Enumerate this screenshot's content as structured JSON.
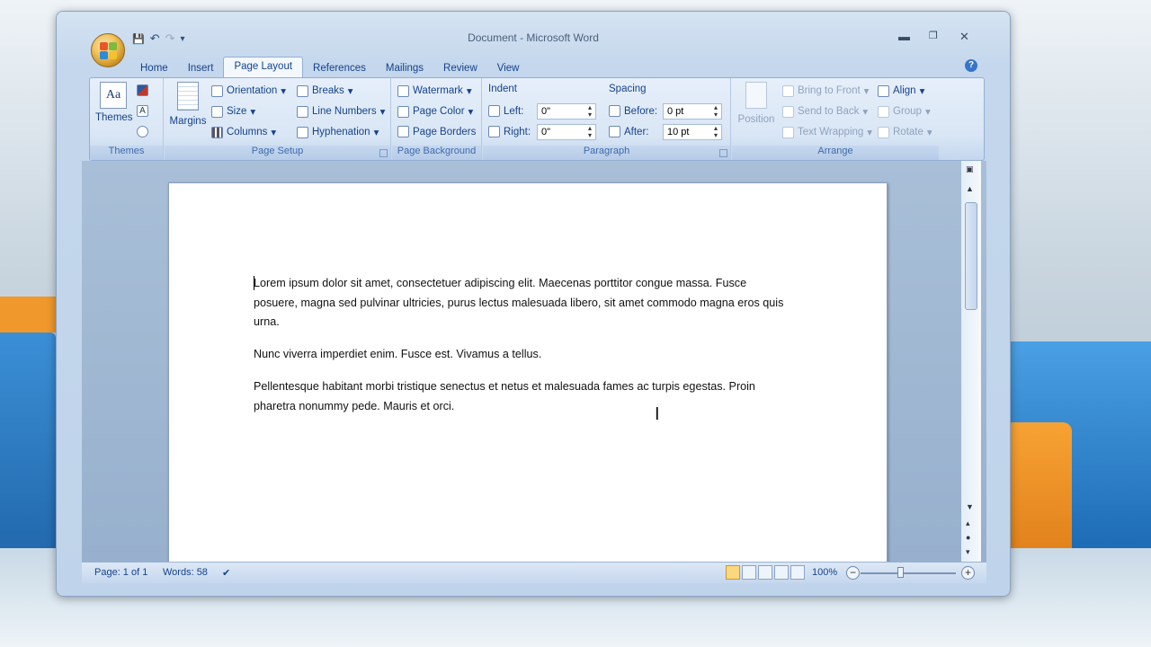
{
  "window": {
    "title": "Document - Microsoft Word",
    "minimize": "▬",
    "maximize": "❐",
    "close": "✕"
  },
  "qat": {
    "save": "💾",
    "undo": "↶",
    "redo": "↷",
    "customize": "▾"
  },
  "tabs": [
    "Home",
    "Insert",
    "Page Layout",
    "References",
    "Mailings",
    "Review",
    "View"
  ],
  "active_tab": "Page Layout",
  "help": "?",
  "ribbon": {
    "themes": {
      "label": "Themes",
      "group": "Themes",
      "themes_icon_text": "Aa"
    },
    "page_setup": {
      "group": "Page Setup",
      "margins": "Margins",
      "orientation": "Orientation",
      "size": "Size",
      "columns": "Columns",
      "breaks": "Breaks",
      "line_numbers": "Line Numbers",
      "hyphenation": "Hyphenation"
    },
    "page_background": {
      "group": "Page Background",
      "watermark": "Watermark",
      "page_color": "Page Color",
      "page_borders": "Page Borders"
    },
    "paragraph": {
      "group": "Paragraph",
      "indent_header": "Indent",
      "spacing_header": "Spacing",
      "left_label": "Left:",
      "left_value": "0\"",
      "right_label": "Right:",
      "right_value": "0\"",
      "before_label": "Before:",
      "before_value": "0 pt",
      "after_label": "After:",
      "after_value": "10 pt"
    },
    "arrange": {
      "group": "Arrange",
      "position": "Position",
      "bring_to_front": "Bring to Front",
      "send_to_back": "Send to Back",
      "text_wrapping": "Text Wrapping",
      "align": "Align",
      "group_btn": "Group",
      "rotate": "Rotate"
    }
  },
  "document": {
    "paragraphs": [
      "Lorem ipsum dolor sit amet, consectetuer adipiscing elit. Maecenas porttitor congue massa. Fusce posuere, magna sed pulvinar ultricies, purus lectus malesuada libero, sit amet commodo magna eros quis urna.",
      "Nunc viverra imperdiet enim. Fusce est. Vivamus a tellus.",
      "Pellentesque habitant morbi tristique senectus et netus et malesuada fames ac turpis egestas. Proin pharetra nonummy pede. Mauris et orci."
    ]
  },
  "status": {
    "page": "Page: 1 of 1",
    "words": "Words: 58",
    "zoom": "100%",
    "zoom_out": "−",
    "zoom_in": "+"
  }
}
